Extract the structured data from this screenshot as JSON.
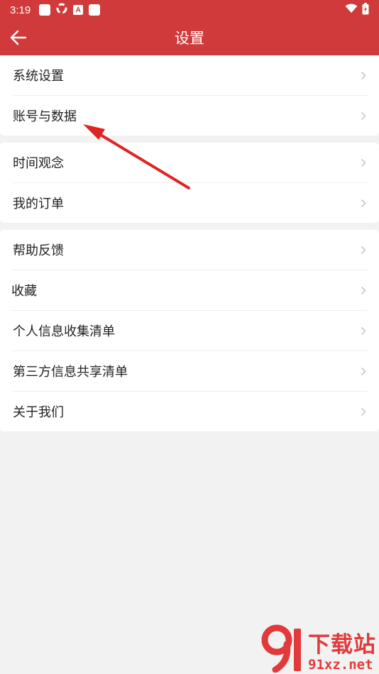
{
  "status_bar": {
    "time": "3:19",
    "icons": [
      "square-icon",
      "sync-icon",
      "a-icon",
      "square-icon",
      "wifi-icon",
      "battery-icon"
    ]
  },
  "header": {
    "title": "设置",
    "back_icon": "arrow-left-icon"
  },
  "groups": [
    {
      "items": [
        {
          "label": "系统设置"
        },
        {
          "label": "账号与数据"
        }
      ]
    },
    {
      "items": [
        {
          "label": "时间观念"
        },
        {
          "label": "我的订单"
        }
      ]
    },
    {
      "items": [
        {
          "label": "帮助反馈"
        },
        {
          "label": "收藏"
        },
        {
          "label": "个人信息收集清单"
        },
        {
          "label": "第三方信息共享清单"
        },
        {
          "label": "关于我们"
        }
      ]
    }
  ],
  "watermark": {
    "brand": "下载站",
    "url": "91xz.net"
  },
  "colors": {
    "brand_red": "#d03a3a",
    "annotation_red": "#e02424",
    "page_bg": "#f2f2f2"
  }
}
